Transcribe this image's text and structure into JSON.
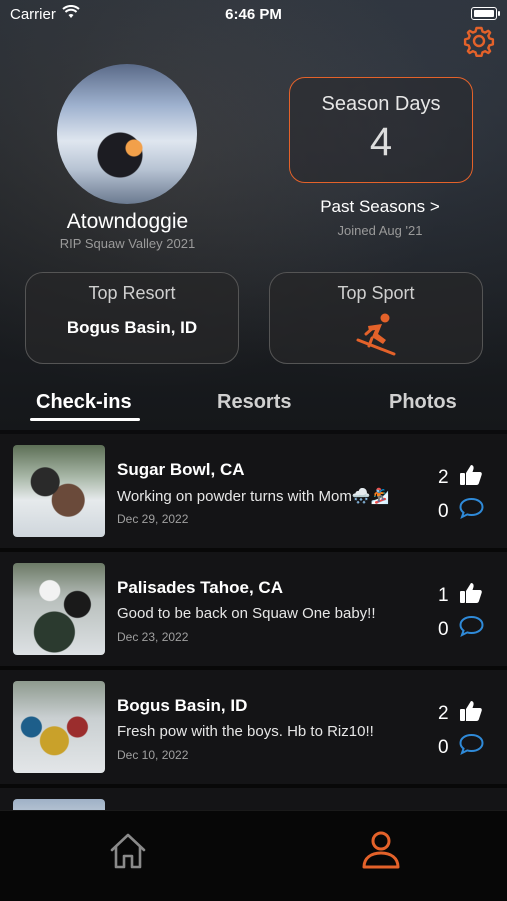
{
  "status_bar": {
    "carrier": "Carrier",
    "time": "6:46 PM"
  },
  "profile": {
    "username": "Atowndoggie",
    "subtitle": "RIP Squaw Valley 2021",
    "season_days_label": "Season Days",
    "season_days_value": "4",
    "past_seasons_label": "Past Seasons >",
    "joined": "Joined Aug '21"
  },
  "cards": {
    "top_resort_label": "Top Resort",
    "top_resort_value": "Bogus Basin, ID",
    "top_sport_label": "Top Sport"
  },
  "tabs": [
    {
      "label": "Check-ins",
      "active": true
    },
    {
      "label": "Resorts",
      "active": false
    },
    {
      "label": "Photos",
      "active": false
    }
  ],
  "checkins": [
    {
      "resort": "Sugar Bowl, CA",
      "text": "Working on powder turns with Mom🌨️🏂",
      "date": "Dec 29, 2022",
      "likes": "2",
      "comments": "0"
    },
    {
      "resort": "Palisades Tahoe, CA",
      "text": "Good to be back on Squaw One baby!!",
      "date": "Dec 23, 2022",
      "likes": "1",
      "comments": "0"
    },
    {
      "resort": "Bogus Basin, ID",
      "text": "Fresh pow with the boys. Hb to Riz10!!",
      "date": "Dec 10, 2022",
      "likes": "2",
      "comments": "0"
    }
  ],
  "colors": {
    "accent": "#e4622a",
    "comment": "#2f8ad8"
  },
  "icons": [
    "wifi-icon",
    "battery-icon",
    "gear-icon",
    "skier-icon",
    "thumbs-up-icon",
    "comment-icon",
    "home-icon",
    "profile-icon"
  ]
}
